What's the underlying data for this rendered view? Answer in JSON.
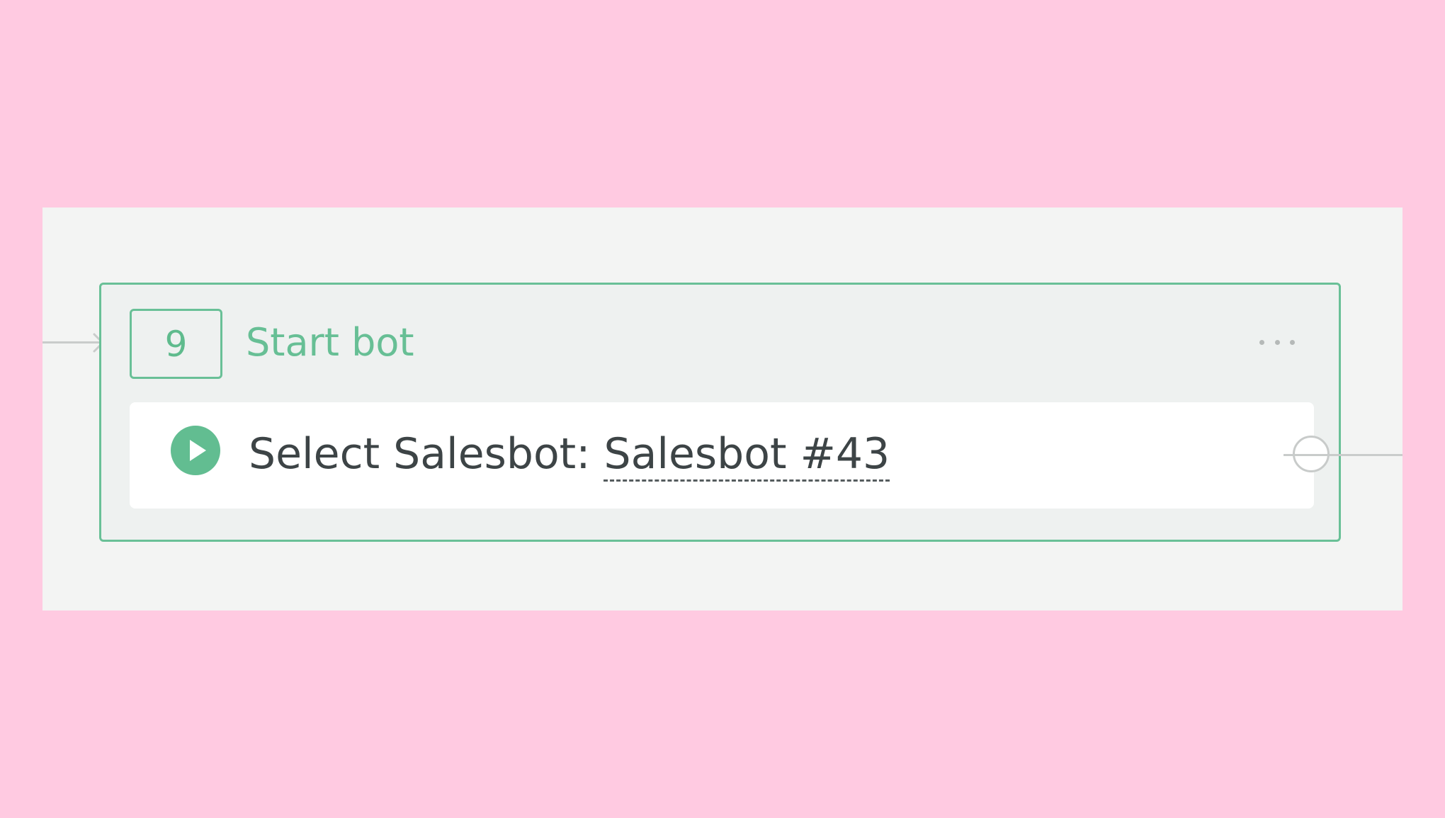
{
  "step": {
    "number": "9",
    "title": "Start bot",
    "more_icon": "more-horizontal-icon"
  },
  "action": {
    "icon": "play-icon",
    "label": "Select Salesbot:",
    "bot_name": "Salesbot #43"
  },
  "colors": {
    "background": "#ffcae1",
    "panel": "#f3f4f3",
    "accent": "#69c097",
    "text": "#3d4446",
    "connector": "#c8cbca"
  }
}
